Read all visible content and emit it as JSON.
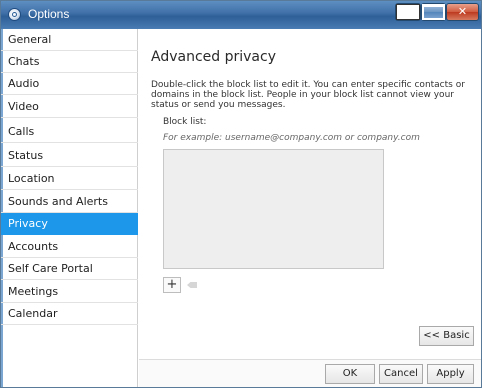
{
  "window": {
    "title": "Options"
  },
  "sidebar": {
    "items": [
      {
        "label": "General"
      },
      {
        "label": "Chats"
      },
      {
        "label": "Audio"
      },
      {
        "label": "Video"
      },
      {
        "label": "Calls"
      },
      {
        "label": "Status"
      },
      {
        "label": "Location"
      },
      {
        "label": "Sounds and Alerts"
      },
      {
        "label": "Privacy",
        "selected": true
      },
      {
        "label": "Accounts"
      },
      {
        "label": "Self Care Portal"
      },
      {
        "label": "Meetings"
      },
      {
        "label": "Calendar"
      }
    ]
  },
  "main": {
    "title": "Advanced privacy",
    "description": "Double-click the block list to edit it. You can enter specific contacts or domains in the block list. People in your block list cannot view your status or send you messages.",
    "block_list_label": "Block list:",
    "example_text": "For example: username@company.com or company.com",
    "add_label": "+",
    "basic_button": "<< Basic"
  },
  "footer": {
    "ok": "OK",
    "cancel": "Cancel",
    "apply": "Apply"
  },
  "colors": {
    "selected": "#1c97ea",
    "titlebar": "#3e6ea6"
  }
}
